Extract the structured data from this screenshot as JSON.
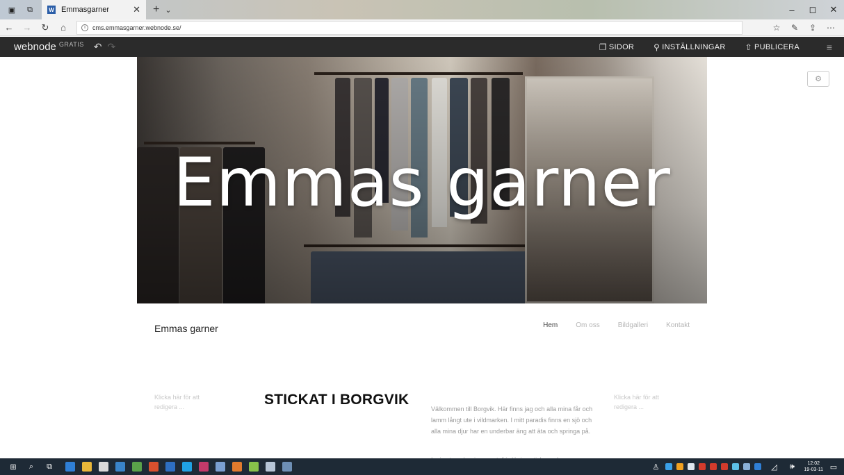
{
  "browser": {
    "tab_title": "Emmasgarner",
    "tab_favicon_letter": "W",
    "url": "cms.emmasgarner.webnode.se/",
    "window_controls": [
      "–",
      "◻",
      "✕"
    ]
  },
  "webnode_toolbar": {
    "logo": "webnode",
    "plan": "GRATIS",
    "actions": {
      "pages": "SIDOR",
      "settings": "INSTÄLLNINGAR",
      "publish": "PUBLICERA"
    }
  },
  "hero": {
    "title": "Emmas garner"
  },
  "site": {
    "name": "Emmas garner",
    "nav": [
      "Hem",
      "Om oss",
      "Bildgalleri",
      "Kontakt"
    ]
  },
  "content": {
    "left_placeholder": "Klicka här för att redigera ...",
    "heading": "STICKAT I BORGVIK",
    "paragraph": "Välkommen till Borgvik. Här finns jag och alla mina får och lamm långt ute i vildmarken. I mitt paradis finns en sjö och alla mina djur har en underbar äng att äta och springa på.",
    "paragraph2": "I min stuga har jag en ateljé där jag stickar och syr",
    "right_placeholder": "Klicka här för att redigera ..."
  },
  "taskbar": {
    "time": "12:02",
    "date": "19-03-11"
  },
  "colors": {
    "toolbar_bg": "#2b2b2b",
    "taskbar_bg": "#1e2a36",
    "heading": "#111111"
  }
}
